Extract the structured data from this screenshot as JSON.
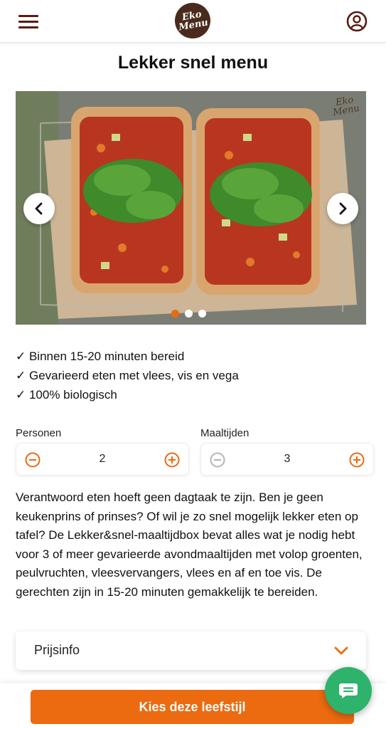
{
  "header": {
    "logo_text_line1": "Eko",
    "logo_text_line2": "Menu",
    "menu_icon": "hamburger-icon",
    "account_icon": "user-circle-icon",
    "brand_color": "#5a1a12"
  },
  "page": {
    "title": "Lekker snel menu"
  },
  "carousel": {
    "watermark_line1": "Eko",
    "watermark_line2": "Menu",
    "active_slide": 1,
    "slide_count": 3,
    "prev_icon": "chevron-left-icon",
    "next_icon": "chevron-right-icon"
  },
  "features": [
    "✓ Binnen 15-20 minuten bereid",
    "✓ Gevarieerd eten met vlees, vis en vega",
    "✓ 100% biologisch"
  ],
  "steppers": {
    "persons": {
      "label": "Personen",
      "value": "2"
    },
    "meals": {
      "label": "Maaltijden",
      "value": "3"
    }
  },
  "description": "Verantwoord eten hoeft geen dagtaak te zijn. Ben je geen keukenprins of prinses? Of wil je zo snel mogelijk lekker eten op tafel? De Lekker&snel-maaltijdbox bevat alles wat je nodig hebt voor 3 of meer gevarieerde avondmaaltijden met volop groenten, peulvruchten, vleesvervangers, vlees en af en toe vis. De gerechten zijn in 15-20 minuten gemakkelijk te bereiden.",
  "accordion": {
    "label": "Prijsinfo",
    "icon": "chevron-down-icon"
  },
  "cta": {
    "label": "Kies deze leefstijl"
  },
  "chat": {
    "icon": "chat-bubble-icon"
  },
  "colors": {
    "accent": "#ec6a10",
    "chat": "#2db36b",
    "disabled": "#b5b5b5"
  }
}
